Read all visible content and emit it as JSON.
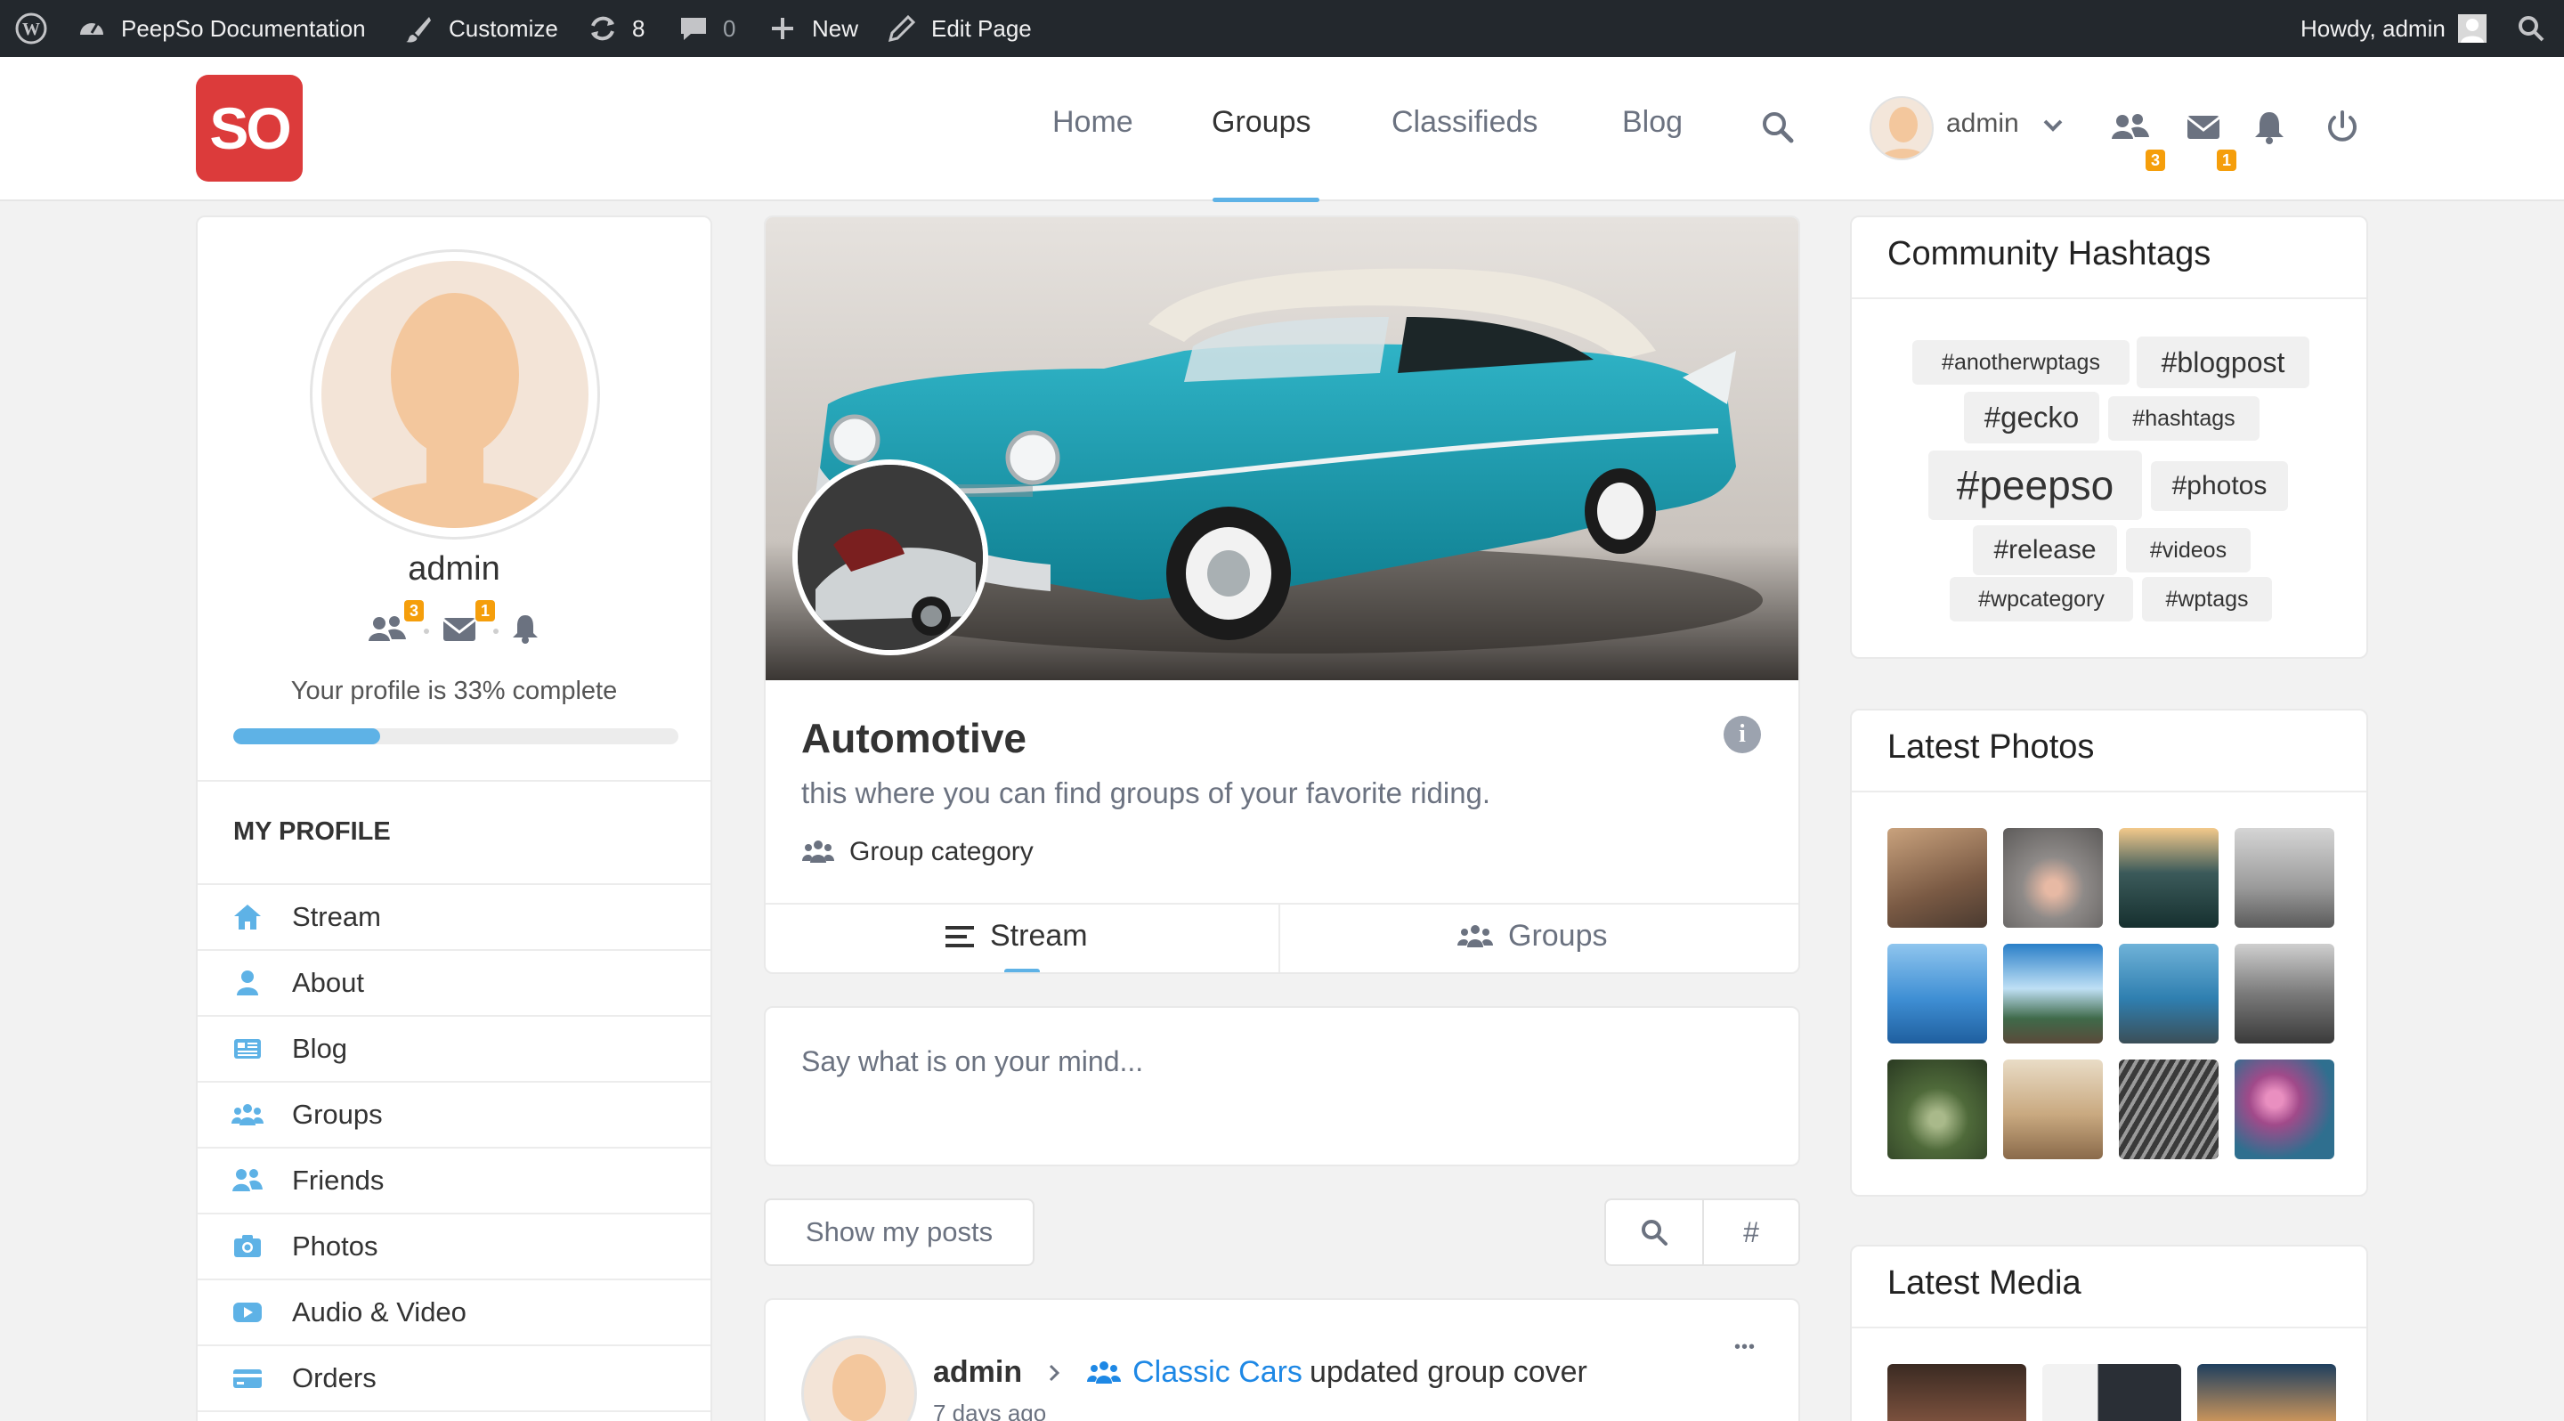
{
  "admin_bar": {
    "site_name": "PeepSo Documentation",
    "customize": "Customize",
    "updates_count": "8",
    "comments_count": "0",
    "new_label": "New",
    "edit_page": "Edit Page",
    "howdy": "Howdy, admin"
  },
  "header": {
    "logo_text": "SO",
    "nav": [
      "Home",
      "Groups",
      "Classifieds",
      "Blog"
    ],
    "active_nav": "Groups",
    "user_name": "admin",
    "friends_badge": "3",
    "messages_badge": "1"
  },
  "profile": {
    "name": "admin",
    "friends_badge": "3",
    "messages_badge": "1",
    "completion_text": "Your profile is 33% complete",
    "completion_fraction": 0.33,
    "section_title": "MY PROFILE",
    "menu": [
      "Stream",
      "About",
      "Blog",
      "Groups",
      "Friends",
      "Photos",
      "Audio & Video",
      "Orders"
    ]
  },
  "group": {
    "name": "Automotive",
    "description": "this where you can find groups of your favorite riding.",
    "category_label": "Group category",
    "tabs": [
      "Stream",
      "Groups"
    ],
    "active_tab": "Stream"
  },
  "composer": {
    "placeholder": "Say what is on your mind..."
  },
  "filters": {
    "show_my_posts": "Show my posts",
    "hashtag_symbol": "#"
  },
  "post": {
    "author": "admin",
    "group_name": "Classic Cars",
    "action": "updated group cover",
    "time": "7 days ago",
    "more_symbol": "•••"
  },
  "hashtags": {
    "title": "Community Hashtags",
    "tags": [
      "#anotherwptags",
      "#blogpost",
      "#gecko",
      "#hashtags",
      "#peepso",
      "#photos",
      "#release",
      "#videos",
      "#wpcategory",
      "#wptags"
    ]
  },
  "latest_photos": {
    "title": "Latest Photos"
  },
  "latest_media": {
    "title": "Latest Media"
  },
  "colors": {
    "accent": "#5eb2e6",
    "brand_red": "#dc3b3b",
    "badge": "#f59e0b",
    "link_blue": "#1e88e5",
    "admin_bar": "#23282d"
  }
}
